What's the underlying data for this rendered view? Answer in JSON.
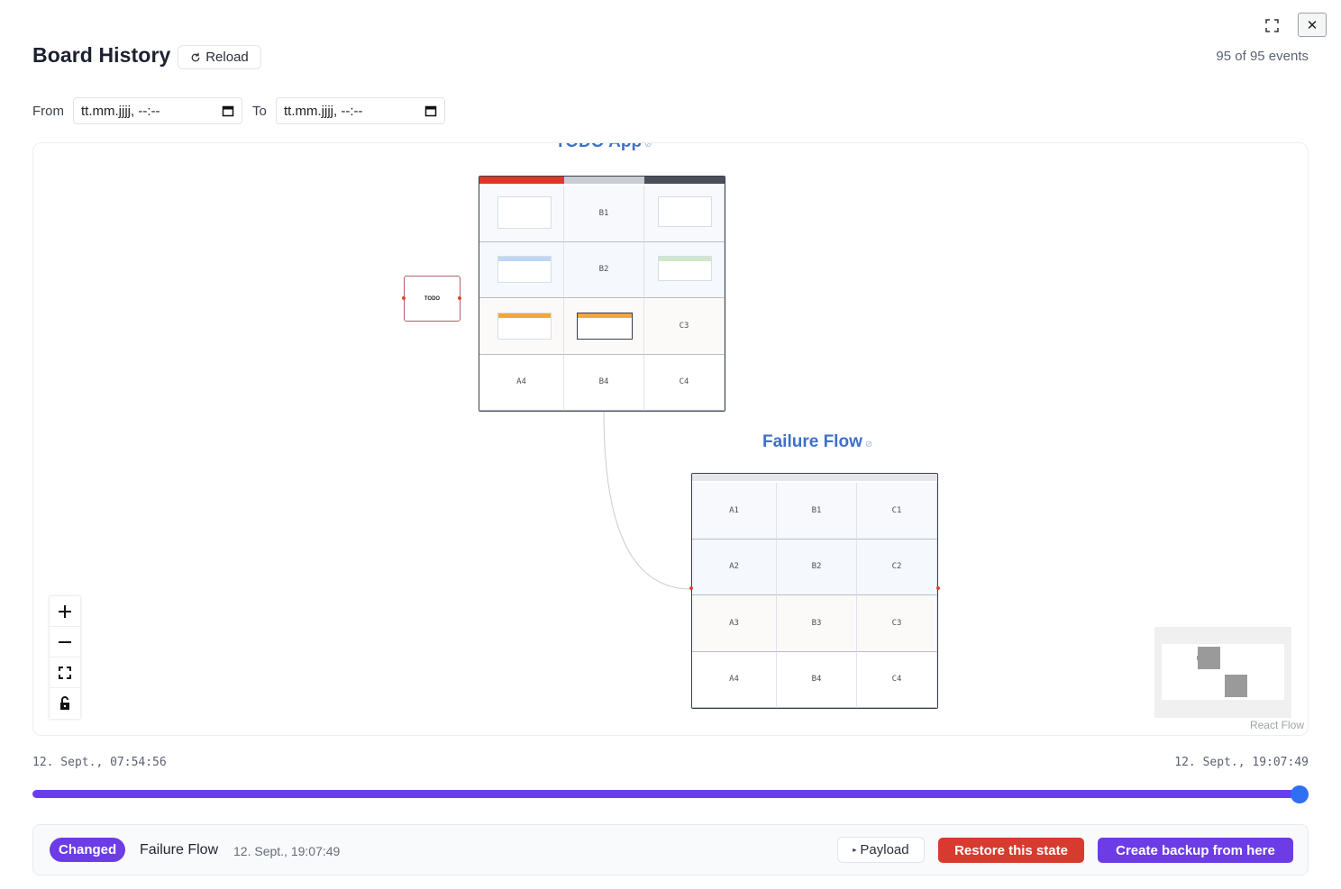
{
  "header": {
    "title": "Board History",
    "reload_label": "Reload",
    "event_count": "95 of 95 events"
  },
  "filters": {
    "from_label": "From",
    "from_value": "tt.mm.jjjj, --:--",
    "to_label": "To",
    "to_value": "tt.mm.jjjj, --:--"
  },
  "canvas": {
    "todo_node_label": "TODO",
    "board1": {
      "title": "TODO App",
      "rows": [
        [
          "",
          "B1",
          ""
        ],
        [
          "",
          "B2",
          ""
        ],
        [
          "",
          "",
          "C3"
        ],
        [
          "A4",
          "B4",
          "C4"
        ]
      ]
    },
    "board2": {
      "title": "Failure Flow",
      "rows": [
        [
          "A1",
          "B1",
          "C1"
        ],
        [
          "A2",
          "B2",
          "C2"
        ],
        [
          "A3",
          "B3",
          "C3"
        ],
        [
          "A4",
          "B4",
          "C4"
        ]
      ]
    },
    "attribution": "React Flow"
  },
  "timeline": {
    "start": "12. Sept., 07:54:56",
    "end": "12. Sept., 19:07:49",
    "position": 1.0
  },
  "footer": {
    "badge": "Changed",
    "event_name": "Failure Flow",
    "event_time": "12. Sept., 19:07:49",
    "payload_label": "Payload",
    "restore_label": "Restore this state",
    "backup_label": "Create backup from here"
  },
  "colors": {
    "accent": "#6c3ce6",
    "danger": "#d73a2e",
    "link": "#3f6fc9",
    "thumb": "#2f6ff2"
  }
}
